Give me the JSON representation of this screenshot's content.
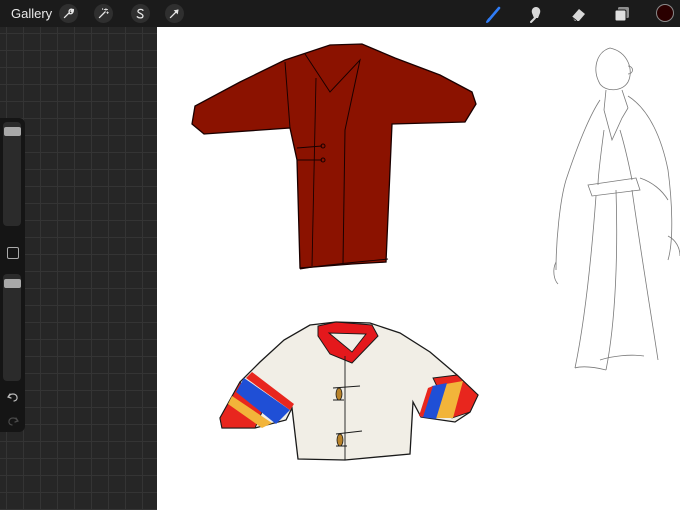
{
  "toolbar": {
    "gallery_label": "Gallery",
    "tools": [
      "wrench-icon",
      "magic-wand-icon",
      "selection-icon",
      "transform-arrow-icon"
    ],
    "right_tools": [
      "brush-icon",
      "smudge-icon",
      "eraser-icon",
      "layers-icon"
    ],
    "active_tool": "brush",
    "accent_color": "#2f7cf6",
    "current_color": "#2a0000"
  },
  "sidebar": {
    "brush_size": 0.95,
    "brush_opacity": 0.95,
    "buttons": [
      "modify-button",
      "undo-icon",
      "redo-icon"
    ]
  },
  "canvas": {
    "background": "#ffffff",
    "drawings": [
      "red-long-coat",
      "white-jacket-striped-sleeves",
      "figure-sketch"
    ],
    "colors": {
      "coat": "#8b1200",
      "jacket_body": "#f1eee6",
      "collar": "#e4181c",
      "stripe_red": "#e8261e",
      "stripe_yellow": "#f2b43a",
      "stripe_blue": "#1f4fd6"
    }
  }
}
